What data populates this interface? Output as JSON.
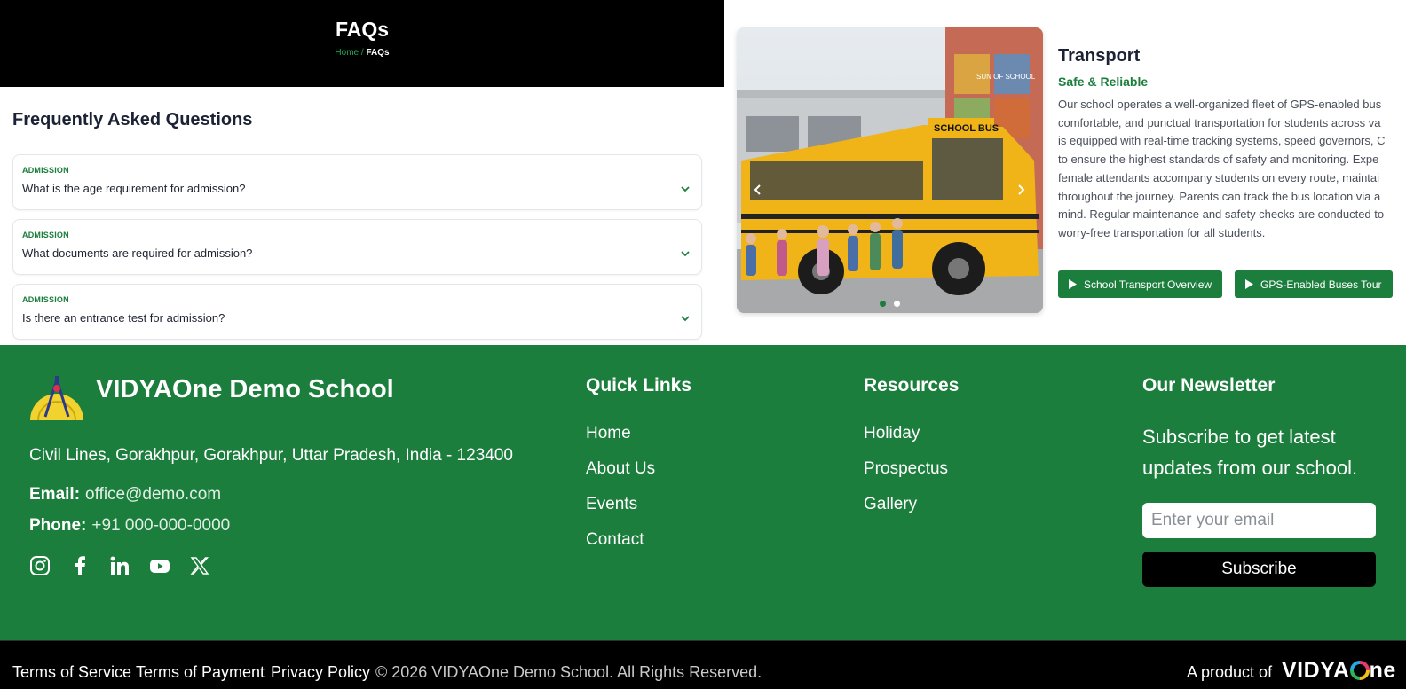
{
  "hero": {
    "title": "FAQs",
    "breadcrumb_home": "Home",
    "breadcrumb_sep": "/",
    "breadcrumb_current": "FAQs"
  },
  "faq": {
    "heading": "Frequently Asked Questions",
    "items": [
      {
        "category": "ADMISSION",
        "question": "What is the age requirement for admission?"
      },
      {
        "category": "ADMISSION",
        "question": "What documents are required for admission?"
      },
      {
        "category": "ADMISSION",
        "question": "Is there an entrance test for admission?"
      }
    ]
  },
  "transport": {
    "title": "Transport",
    "subtitle": "Safe & Reliable",
    "description": "Our school operates a well-organized fleet of GPS-enabled bus\ncomfortable, and punctual transportation for students across va\nis equipped with real-time tracking systems, speed governors, C\nto ensure the highest standards of safety and monitoring. Expe\nfemale attendants accompany students on every route, maintai\nthroughout the journey. Parents can track the bus location via a\nmind. Regular maintenance and safety checks are conducted to\nworry-free transportation for all students.",
    "bus_sign": "SCHOOL BUS",
    "building_sign": "SUN OF SCHOOL",
    "slide_count": 2,
    "active_slide": 1,
    "buttons": [
      {
        "label": "School Transport Overview",
        "icon": "play-icon"
      },
      {
        "label": "GPS-Enabled Buses Tour",
        "icon": "play-icon"
      }
    ]
  },
  "footer": {
    "school_name": "VIDYAOne Demo School",
    "address": "Civil Lines, Gorakhpur, Gorakhpur, Uttar Pradesh, India - 123400",
    "email_label": "Email:",
    "email": "office@demo.com",
    "phone_label": "Phone:",
    "phone": "+91 000-000-0000",
    "socials": [
      "instagram-icon",
      "facebook-icon",
      "linkedin-icon",
      "youtube-icon",
      "x-icon"
    ],
    "quick_links": {
      "heading": "Quick Links",
      "items": [
        "Home",
        "About Us",
        "Events",
        "Contact"
      ]
    },
    "resources": {
      "heading": "Resources",
      "items": [
        "Holiday",
        "Prospectus",
        "Gallery"
      ]
    },
    "newsletter": {
      "heading": "Our Newsletter",
      "text": "Subscribe to get latest updates from our school.",
      "placeholder": "Enter your email",
      "button": "Subscribe"
    }
  },
  "bottom": {
    "links": [
      "Terms of Service",
      "Terms of Payment",
      "Privacy Policy"
    ],
    "copyright": "© 2026 VIDYAOne Demo School. All Rights Reserved.",
    "product_prefix": "A product of",
    "brand_left": "VIDYA",
    "brand_right": "ne"
  },
  "colors": {
    "brand_green": "#1b7e3c",
    "accent_green": "#22a559",
    "black": "#000000"
  }
}
